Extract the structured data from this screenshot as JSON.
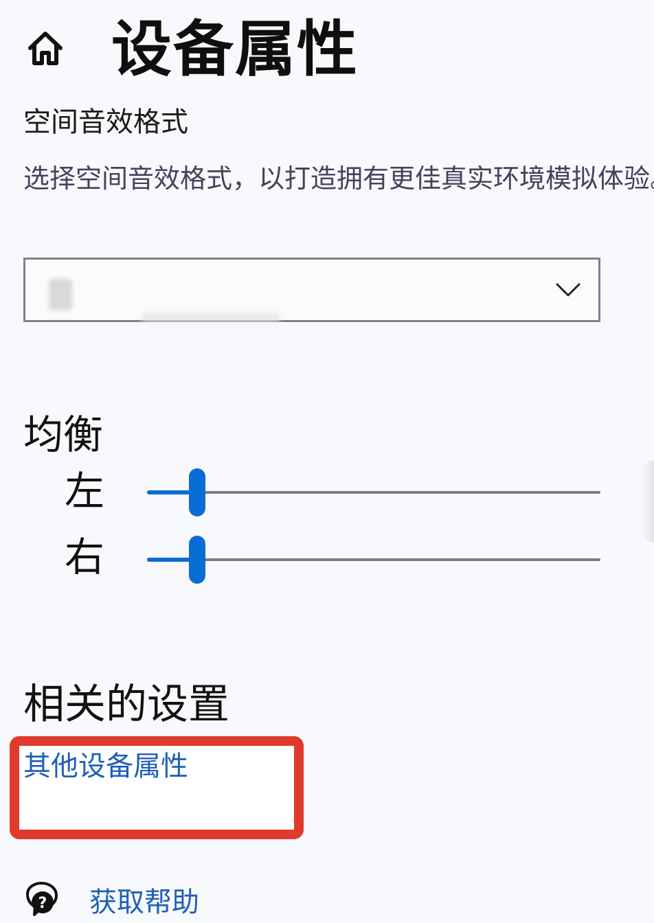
{
  "header": {
    "home_icon": "home-icon",
    "title": "设备属性"
  },
  "spatial_sound": {
    "label": "空间音效格式",
    "description": "选择空间音效格式，以打造拥有更佳真实环境模拟体验。",
    "dropdown": {
      "value": "",
      "icon": "chevron-down-icon"
    }
  },
  "balance": {
    "title": "均衡",
    "left": {
      "label": "左",
      "level_fraction": 0.11
    },
    "right": {
      "label": "右",
      "level_fraction": 0.11
    }
  },
  "related": {
    "title": "相关的设置",
    "link": "其他设备属性",
    "highlight_color": "#e03a2f"
  },
  "help": {
    "icon": "help-chat-icon",
    "link": "获取帮助"
  },
  "colors": {
    "accent": "#0a6cd6",
    "link": "#1f5fb8",
    "description": "#4a3f5c"
  }
}
